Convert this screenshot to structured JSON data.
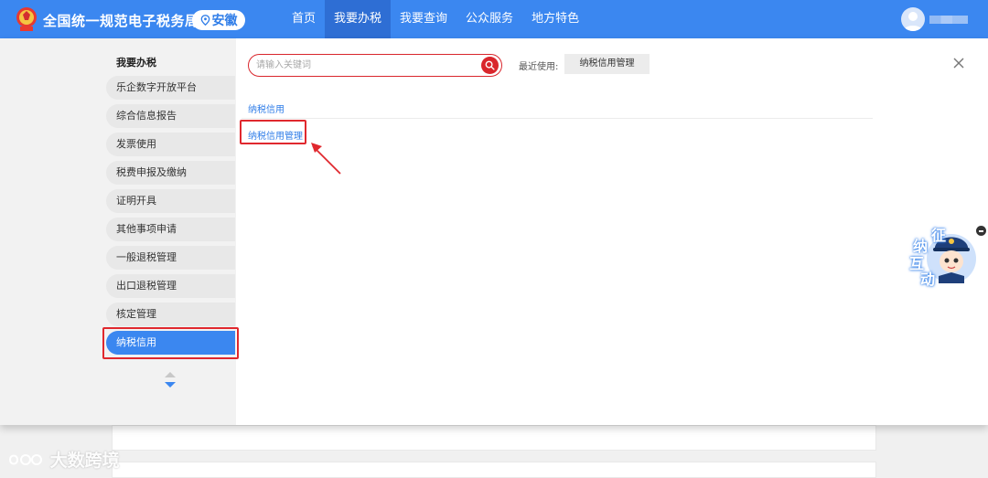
{
  "header": {
    "site_title": "全国统一规范电子税务局",
    "region": "安徽",
    "nav": [
      {
        "label": "首页",
        "active": false
      },
      {
        "label": "我要办税",
        "active": true
      },
      {
        "label": "我要查询",
        "active": false
      },
      {
        "label": "公众服务",
        "active": false
      },
      {
        "label": "地方特色",
        "active": false
      }
    ]
  },
  "sidebar": {
    "heading": "我要办税",
    "items": [
      {
        "label": "乐企数字开放平台"
      },
      {
        "label": "综合信息报告"
      },
      {
        "label": "发票使用"
      },
      {
        "label": "税费申报及缴纳"
      },
      {
        "label": "证明开具"
      },
      {
        "label": "其他事项申请"
      },
      {
        "label": "一般退税管理"
      },
      {
        "label": "出口退税管理"
      },
      {
        "label": "核定管理"
      },
      {
        "label": "纳税信用"
      }
    ],
    "active_index": 9
  },
  "search": {
    "placeholder": "请输入关键词"
  },
  "recent": {
    "label": "最近使用:",
    "items": [
      "纳税信用管理"
    ]
  },
  "content": {
    "category_title": "纳税信用",
    "items": [
      "纳税信用管理"
    ]
  },
  "widget": {
    "chars": [
      "征",
      "纳",
      "互",
      "动"
    ]
  },
  "watermark": {
    "text": "大数跨境"
  },
  "colors": {
    "primary": "#3b87f0",
    "nav_active": "#2e6ed4",
    "highlight": "#e0282e",
    "link": "#2f7de8"
  }
}
